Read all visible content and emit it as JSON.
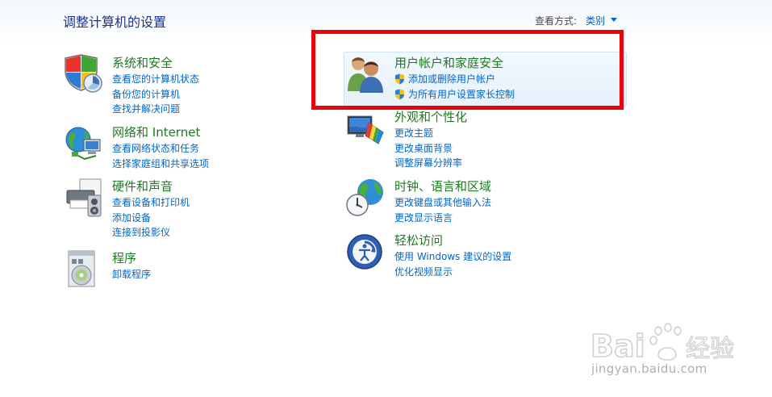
{
  "page": {
    "title": "调整计算机的设置"
  },
  "view_by": {
    "label": "查看方式:",
    "value": "类别"
  },
  "left_column": [
    {
      "title": "系统和安全",
      "icon": "shield-icon",
      "links": [
        "查看您的计算机状态",
        "备份您的计算机",
        "查找并解决问题"
      ]
    },
    {
      "title": "网络和 Internet",
      "icon": "network-globe-icon",
      "links": [
        "查看网络状态和任务",
        "选择家庭组和共享选项"
      ]
    },
    {
      "title": "硬件和声音",
      "icon": "printer-icon",
      "links": [
        "查看设备和打印机",
        "添加设备",
        "连接到投影仪"
      ]
    },
    {
      "title": "程序",
      "icon": "programs-disc-icon",
      "links": [
        "卸载程序"
      ]
    }
  ],
  "right_column": [
    {
      "title": "用户帐户和家庭安全",
      "icon": "users-icon",
      "links": [
        "添加或删除用户帐户",
        "为所有用户设置家长控制"
      ]
    },
    {
      "title": "外观和个性化",
      "icon": "monitor-palette-icon",
      "links": [
        "更改主题",
        "更改桌面背景",
        "调整屏幕分辨率"
      ]
    },
    {
      "title": "时钟、语言和区域",
      "icon": "clock-globe-icon",
      "links": [
        "更改键盘或其他输入法",
        "更改显示语言"
      ]
    },
    {
      "title": "轻松访问",
      "icon": "ease-of-access-icon",
      "links": [
        "使用 Windows 建议的设置",
        "优化视频显示"
      ]
    }
  ],
  "watermark": {
    "brand": "Bai 经验",
    "url": "jingyan.baidu.com"
  },
  "colors": {
    "category_title": "#1e7a21",
    "link": "#0066cc",
    "page_title": "#1e3287",
    "annotation_box": "#e8060c"
  }
}
